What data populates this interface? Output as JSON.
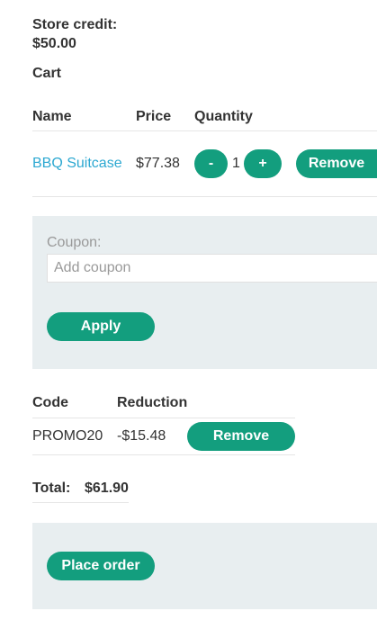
{
  "store_credit": {
    "label": "Store credit:",
    "amount": "$50.00"
  },
  "cart": {
    "heading": "Cart",
    "columns": {
      "name": "Name",
      "price": "Price",
      "quantity": "Quantity"
    },
    "items": [
      {
        "name": "BBQ Suitcase",
        "price": "$77.38",
        "quantity": "1",
        "minus_label": "-",
        "plus_label": "+",
        "remove_label": "Remove"
      }
    ]
  },
  "coupon": {
    "label": "Coupon:",
    "placeholder": "Add coupon",
    "value": "",
    "apply_label": "Apply"
  },
  "applied_coupons": {
    "columns": {
      "code": "Code",
      "reduction": "Reduction"
    },
    "rows": [
      {
        "code": "PROMO20",
        "reduction": "-$15.48",
        "remove_label": "Remove"
      }
    ]
  },
  "total": {
    "label": "Total:",
    "value": "$61.90"
  },
  "order": {
    "place_order_label": "Place order"
  },
  "colors": {
    "accent": "#139e7e",
    "link": "#2ca8d1",
    "panel_bg": "#e8eef0"
  }
}
